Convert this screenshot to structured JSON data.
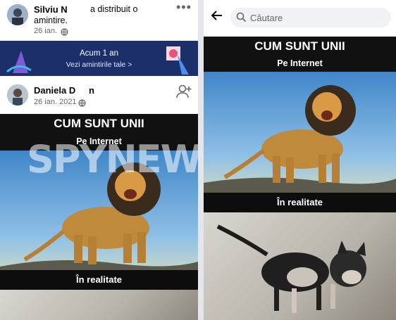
{
  "left": {
    "post1": {
      "name": "Silviu N",
      "action": "a distribuit o",
      "action2": "amintire.",
      "date": "26 ian.",
      "more": "•••"
    },
    "memories_banner": {
      "title": "Acum 1 an",
      "link": "Vezi amintirile tale >"
    },
    "post2": {
      "name": "Daniela D",
      "name_suffix": "n",
      "date": "26 ian. 2021",
      "meme_title": "CUM SUNT UNII",
      "meme_subtitle": "Pe Internet",
      "meme_footer": "În realitate"
    },
    "watermark": "SPYNEWS"
  },
  "right": {
    "search": {
      "placeholder": "Căutare"
    },
    "meme_title": "CUM SUNT UNII",
    "meme_subtitle": "Pe Internet",
    "meme_footer": "În realitate"
  },
  "icons": [
    "globe-icon",
    "back-arrow-icon",
    "search-icon",
    "add-friend-icon",
    "more-icon"
  ]
}
